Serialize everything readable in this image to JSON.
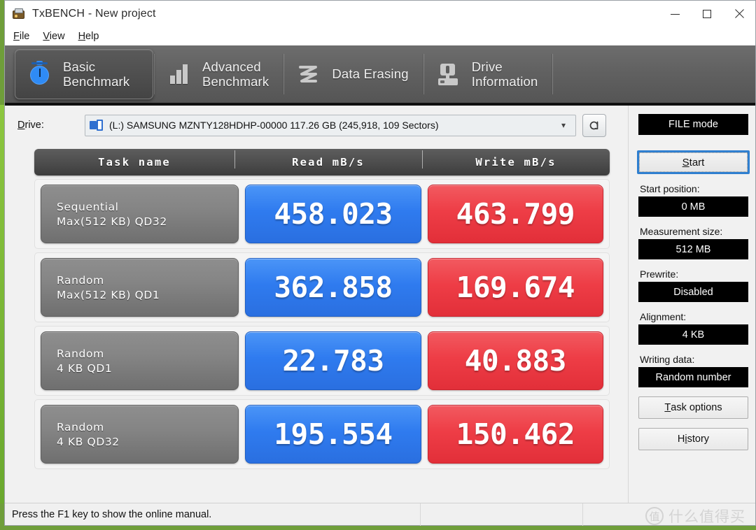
{
  "window": {
    "title": "TxBENCH - New project",
    "app_icon": "drive-bench-icon",
    "minimize": "minimize-icon",
    "maximize": "maximize-icon",
    "close": "close-icon"
  },
  "menubar": {
    "items": [
      {
        "label": "File",
        "accel": "F"
      },
      {
        "label": "View",
        "accel": "V"
      },
      {
        "label": "Help",
        "accel": "H"
      }
    ]
  },
  "tabs": [
    {
      "label": "Basic\nBenchmark",
      "icon": "stopwatch-icon",
      "active": true
    },
    {
      "label": "Advanced\nBenchmark",
      "icon": "bar-chart-icon",
      "active": false
    },
    {
      "label": "Data Erasing",
      "icon": "zigzag-eraser-icon",
      "active": false
    },
    {
      "label": "Drive\nInformation",
      "icon": "drive-info-icon",
      "active": false
    }
  ],
  "drive": {
    "label": "Drive:",
    "accel": "D",
    "selected": "(L:) SAMSUNG MZNTY128HDHP-00000  117.26 GB (245,918, 109 Sectors)",
    "icon": "drive-icon",
    "dropdown_arrow": "chevron-down-icon",
    "refresh_icon": "refresh-icon"
  },
  "table": {
    "headers": [
      "Task name",
      "Read mB/s",
      "Write mB/s"
    ],
    "rows": [
      {
        "task_line1": "Sequential",
        "task_line2": "Max(512 KB) QD32",
        "read": "458.023",
        "write": "463.799"
      },
      {
        "task_line1": "Random",
        "task_line2": "Max(512 KB) QD1",
        "read": "362.858",
        "write": "169.674"
      },
      {
        "task_line1": "Random",
        "task_line2": "4 KB QD1",
        "read": "22.783",
        "write": "40.883"
      },
      {
        "task_line1": "Random",
        "task_line2": "4 KB QD32",
        "read": "195.554",
        "write": "150.462"
      }
    ]
  },
  "panel": {
    "mode_button": "FILE mode",
    "start_button": "Start",
    "start_accel": "S",
    "start_position_label": "Start position:",
    "start_position_value": "0 MB",
    "measurement_size_label": "Measurement size:",
    "measurement_size_value": "512 MB",
    "prewrite_label": "Prewrite:",
    "prewrite_value": "Disabled",
    "alignment_label": "Alignment:",
    "alignment_value": "4 KB",
    "writing_data_label": "Writing data:",
    "writing_data_value": "Random number",
    "task_options_button": "Task options",
    "task_options_accel": "T",
    "history_button": "History",
    "history_accel": "H"
  },
  "statusbar": {
    "message": "Press the F1 key to show the online manual.",
    "segment2": "",
    "segment3": ""
  },
  "watermark": {
    "badge": "值",
    "text": "什么值得买"
  },
  "colors": {
    "read_blue": "#2f7bef",
    "write_red": "#ee3d46",
    "task_gray": "#858585",
    "header_dark": "#4c4c4c",
    "accent_focus": "#2f7fd0",
    "desktop_green": "#6f9e3a"
  },
  "chart_data": {
    "type": "bar",
    "title": "TxBENCH Basic Benchmark Results",
    "xlabel": "Task",
    "ylabel": "MB/s",
    "categories": [
      "Sequential Max(512 KB) QD32",
      "Random Max(512 KB) QD1",
      "Random 4 KB QD1",
      "Random 4 KB QD32"
    ],
    "series": [
      {
        "name": "Read mB/s",
        "values": [
          458.023,
          362.858,
          22.783,
          195.554
        ]
      },
      {
        "name": "Write mB/s",
        "values": [
          463.799,
          169.674,
          40.883,
          150.462
        ]
      }
    ],
    "ylim": [
      0,
      500
    ],
    "grid": false,
    "legend": "top"
  }
}
